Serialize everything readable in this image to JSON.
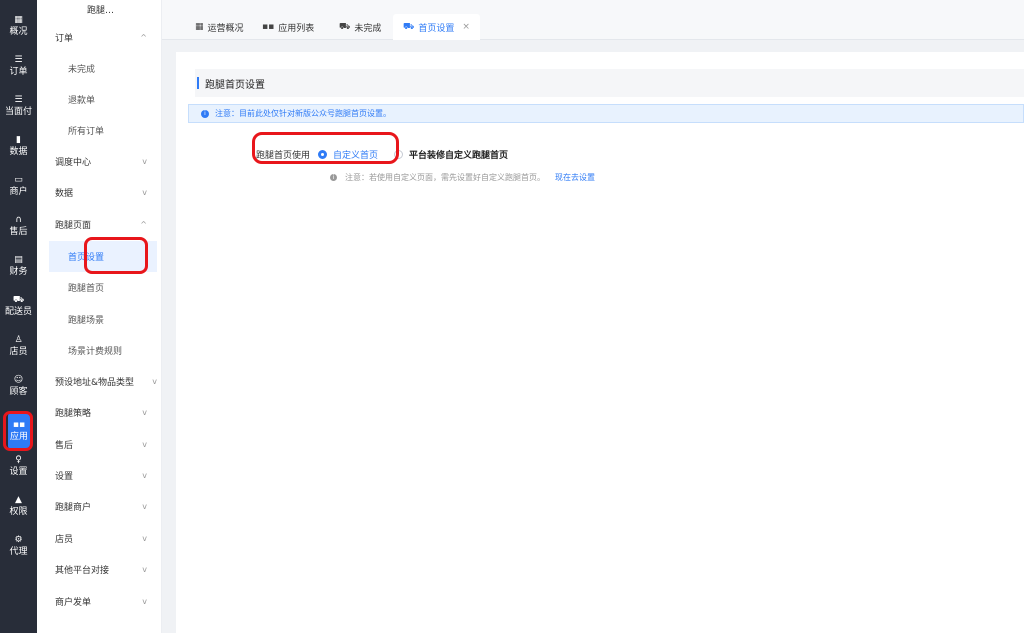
{
  "rail": {
    "items": [
      {
        "icon": "▦",
        "label": "概况"
      },
      {
        "icon": "☰",
        "label": "订单"
      },
      {
        "icon": "☰",
        "label": "当面付"
      },
      {
        "icon": "▮",
        "label": "数据"
      },
      {
        "icon": "▭",
        "label": "商户"
      },
      {
        "icon": "∩",
        "label": "售后"
      },
      {
        "icon": "▤",
        "label": "财务"
      },
      {
        "icon": "⛟",
        "label": "配送员"
      },
      {
        "icon": "♙",
        "label": "店员"
      },
      {
        "icon": "☺",
        "label": "顾客"
      },
      {
        "icon": "▪▪",
        "label": "应用"
      },
      {
        "icon": "♀",
        "label": "设置"
      },
      {
        "icon": "▲",
        "label": "权限"
      },
      {
        "icon": "⚙",
        "label": "代理"
      }
    ]
  },
  "menu": {
    "title": "跑腿…",
    "items": [
      {
        "label": "订单",
        "chevron": "^"
      },
      {
        "label": "未完成"
      },
      {
        "label": "退款单"
      },
      {
        "label": "所有订单"
      },
      {
        "label": "调度中心",
        "chevron": "v"
      },
      {
        "label": "数据",
        "chevron": "v"
      },
      {
        "label": "跑腿页面",
        "chevron": "^"
      },
      {
        "label": "首页设置"
      },
      {
        "label": "跑腿首页"
      },
      {
        "label": "跑腿场景"
      },
      {
        "label": "场景计费规则"
      },
      {
        "label": "预设地址&物品类型",
        "chevron": "v"
      },
      {
        "label": "跑腿策略",
        "chevron": "v"
      },
      {
        "label": "售后",
        "chevron": "v"
      },
      {
        "label": "设置",
        "chevron": "v"
      },
      {
        "label": "跑腿商户",
        "chevron": "v"
      },
      {
        "label": "店员",
        "chevron": "v"
      },
      {
        "label": "其他平台对接",
        "chevron": "v"
      },
      {
        "label": "商户发单",
        "chevron": "v"
      }
    ]
  },
  "tabs": [
    {
      "icon": "▦",
      "label": "运营概况"
    },
    {
      "icon": "▪▪",
      "label": "应用列表"
    },
    {
      "icon": "⛟",
      "label": "未完成"
    },
    {
      "icon": "⛟",
      "label": "首页设置",
      "close": "×"
    }
  ],
  "main": {
    "section_title": "跑腿首页设置",
    "notice_icon": "i",
    "notice": "注意：目前此处仅针对新版公众号跑腿首页设置。",
    "form": {
      "label": "跑腿首页使用",
      "option_selected": "自定义首页",
      "option_other": "平台装修自定义跑腿首页"
    },
    "tip_icon": "i",
    "tip": "注意：若使用自定义页面，需先设置好自定义跑腿首页。",
    "tip_link": "现在去设置"
  },
  "colors": {
    "accent": "#2f7bf6",
    "rail_bg": "#282d39",
    "highlight": "#e8161b"
  }
}
